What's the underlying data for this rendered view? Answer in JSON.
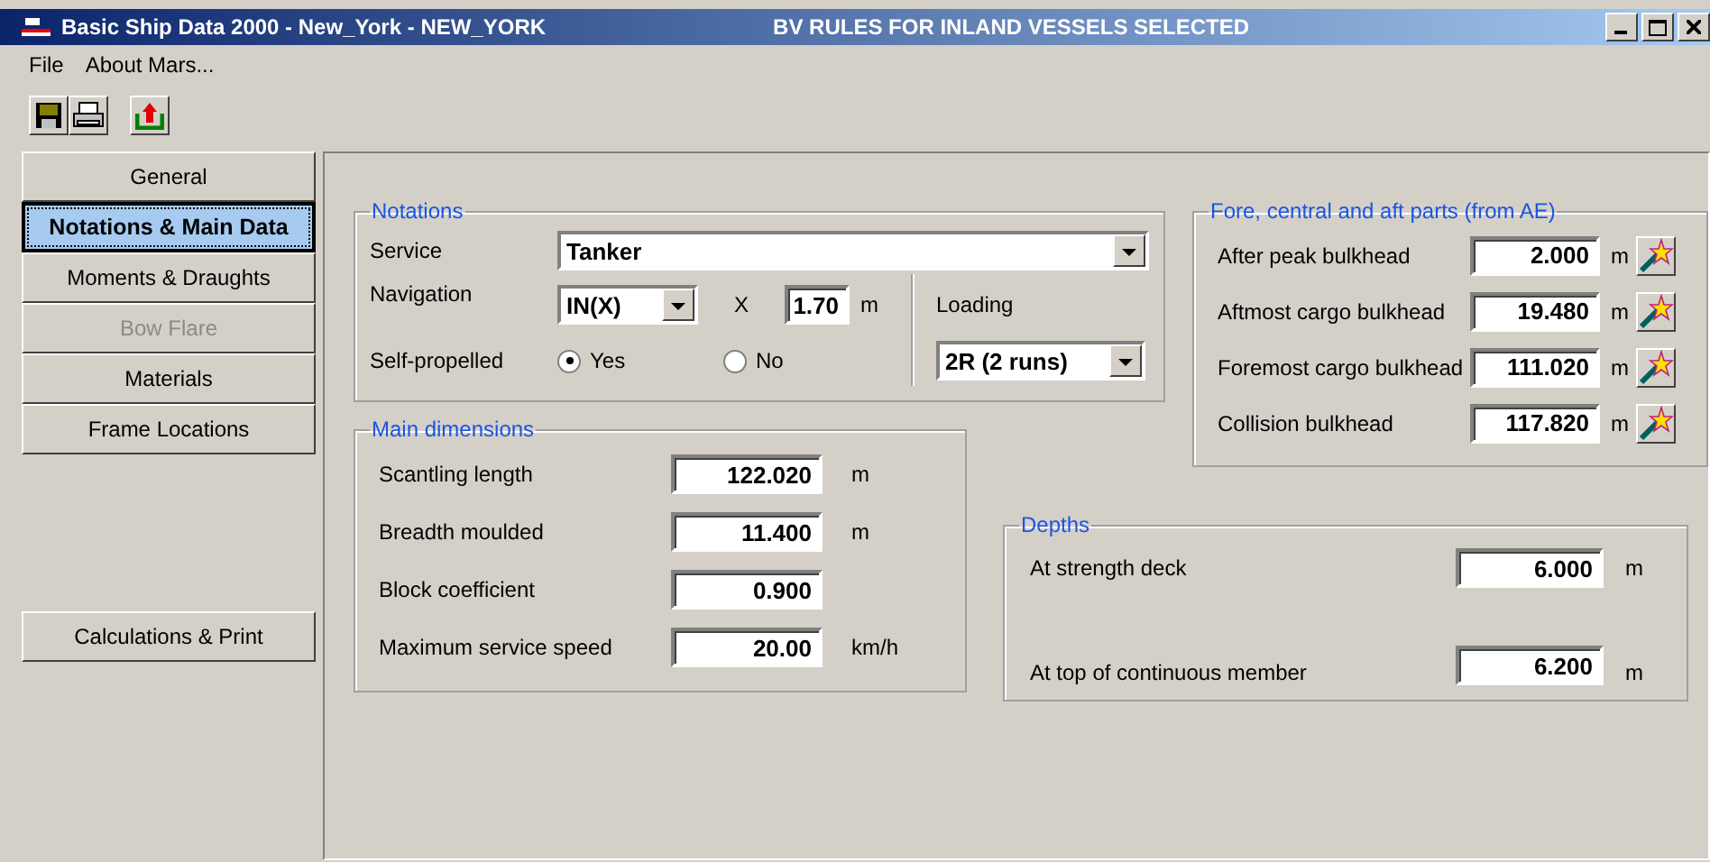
{
  "window": {
    "title": "Basic Ship Data 2000 - New_York - NEW_YORK",
    "banner": "BV RULES FOR INLAND VESSELS SELECTED"
  },
  "menu": [
    "File",
    "About Mars..."
  ],
  "sidebar": {
    "items": [
      {
        "label": "General",
        "selected": false,
        "disabled": false
      },
      {
        "label": "Notations & Main Data",
        "selected": true,
        "disabled": false
      },
      {
        "label": "Moments & Draughts",
        "selected": false,
        "disabled": false
      },
      {
        "label": "Bow Flare",
        "selected": false,
        "disabled": true
      },
      {
        "label": "Materials",
        "selected": false,
        "disabled": false
      },
      {
        "label": "Frame Locations",
        "selected": false,
        "disabled": false
      }
    ],
    "footer_button": "Calculations & Print"
  },
  "notations": {
    "title": "Notations",
    "service": {
      "label": "Service",
      "value": "Tanker"
    },
    "navigation": {
      "label": "Navigation",
      "value": "IN(X)"
    },
    "x": {
      "label": "X",
      "value": "1.70",
      "unit": "m"
    },
    "loading": {
      "label": "Loading",
      "value": "2R (2 runs)"
    },
    "self_propelled": {
      "label": "Self-propelled",
      "options": [
        {
          "label": "Yes",
          "selected": true
        },
        {
          "label": "No",
          "selected": false
        }
      ]
    }
  },
  "main_dimensions": {
    "title": "Main dimensions",
    "fields": [
      {
        "label": "Scantling length",
        "value": "122.020",
        "unit": "m"
      },
      {
        "label": "Breadth moulded",
        "value": "11.400",
        "unit": "m"
      },
      {
        "label": "Block coefficient",
        "value": "0.900"
      },
      {
        "label": "Maximum service speed",
        "value": "20.00",
        "unit": "km/h"
      }
    ]
  },
  "fore_parts": {
    "title": "Fore, central and aft parts (from AE)",
    "fields": [
      {
        "label": "After peak bulkhead",
        "value": "2.000",
        "unit": "m"
      },
      {
        "label": "Aftmost cargo bulkhead",
        "value": "19.480",
        "unit": "m"
      },
      {
        "label": "Foremost cargo bulkhead",
        "value": "111.020",
        "unit": "m"
      },
      {
        "label": "Collision bulkhead",
        "value": "117.820",
        "unit": "m"
      }
    ]
  },
  "depths": {
    "title": "Depths",
    "fields": [
      {
        "label": "At strength deck",
        "value": "6.000",
        "unit": "m"
      },
      {
        "label": "At top of continuous member",
        "value": "6.200",
        "unit": "m"
      }
    ]
  }
}
